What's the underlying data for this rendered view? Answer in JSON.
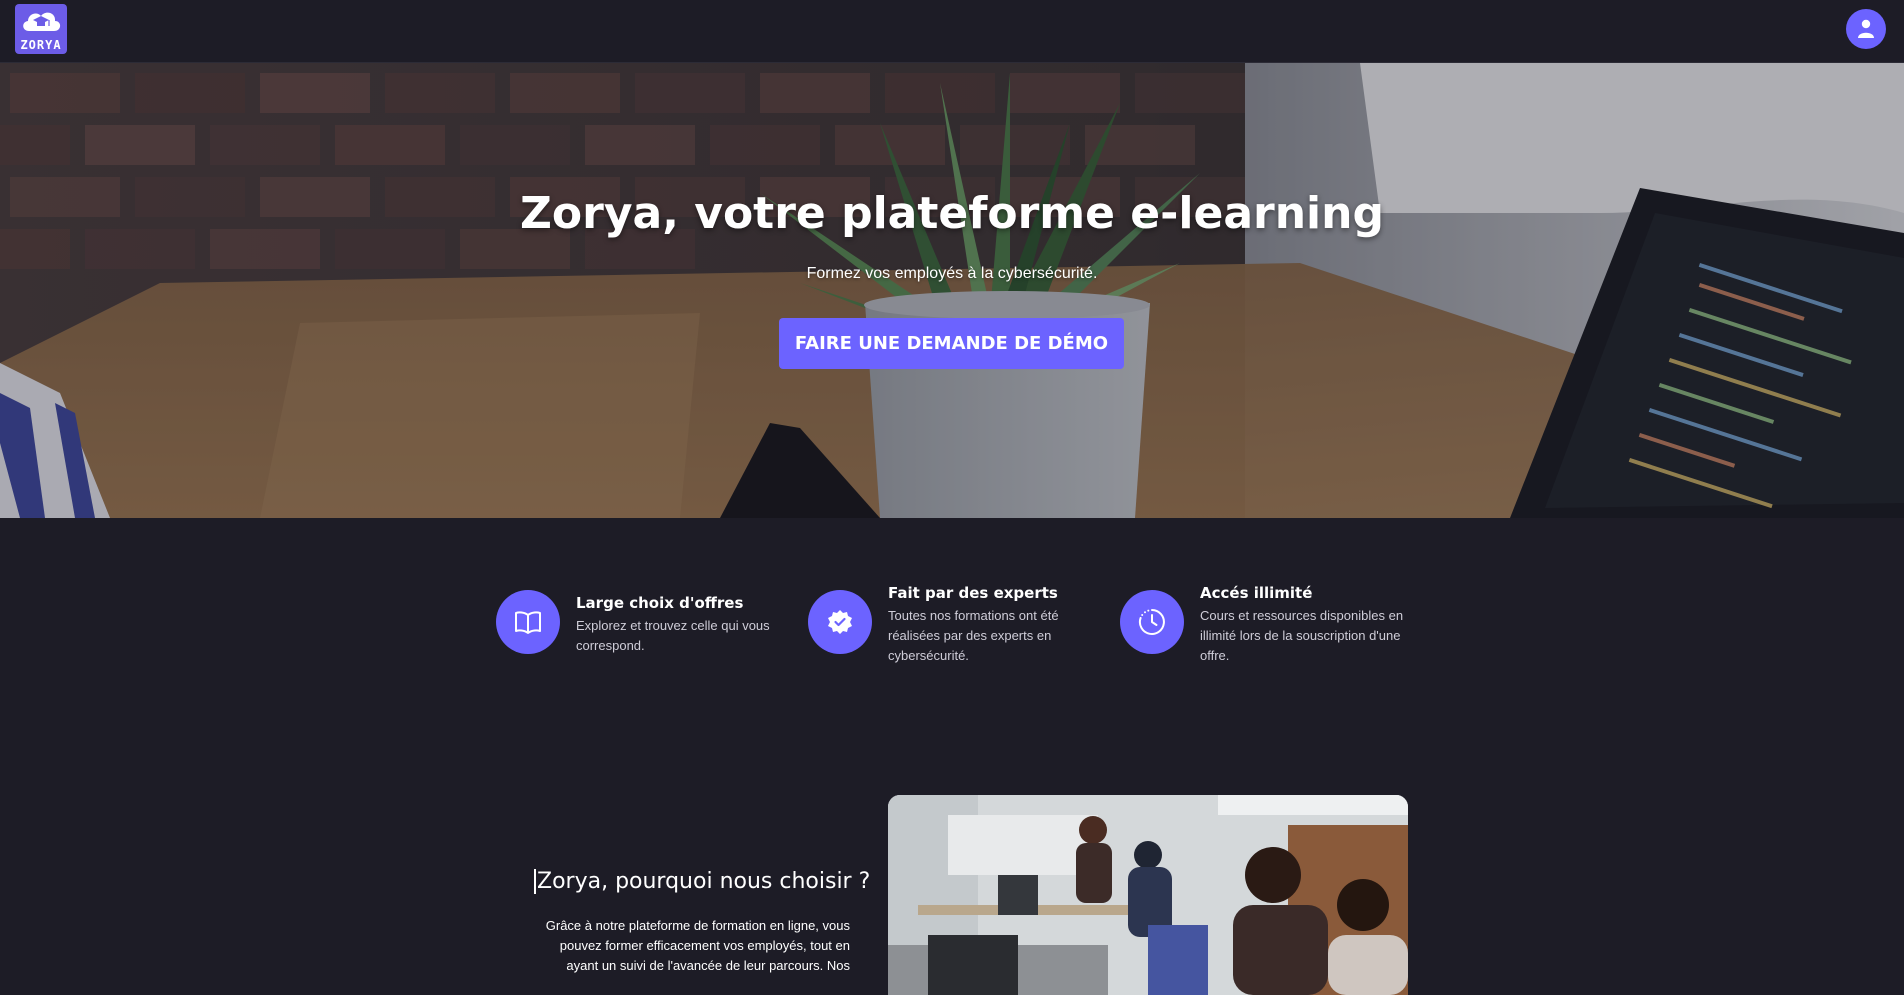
{
  "navbar": {
    "logo_text": "ZORYA"
  },
  "hero": {
    "title": "Zorya, votre plateforme e-learning",
    "subtitle": "Formez vos employés à la cybersécurité.",
    "cta_label": "FAIRE UNE DEMANDE DE DÉMO"
  },
  "features": [
    {
      "icon": "book-icon",
      "title": "Large choix d'offres",
      "description": "Explorez et trouvez celle qui vous correspond."
    },
    {
      "icon": "verified-badge-icon",
      "title": "Fait par des experts",
      "description": "Toutes nos formations ont été réalisées par des experts en cybersécurité."
    },
    {
      "icon": "clock-icon",
      "title": "Accés illimité",
      "description": "Cours et ressources disponibles en illimité lors de la souscription d'une offre."
    }
  ],
  "why": {
    "title": "Zorya, pourquoi nous choisir ?",
    "text": "Grâce à notre plateforme de formation en ligne, vous pouvez former efficacement vos employés, tout en ayant un suivi de l'avancée de leur parcours. Nos"
  },
  "colors": {
    "accent": "#6c63ff",
    "background": "#1d1c26"
  }
}
